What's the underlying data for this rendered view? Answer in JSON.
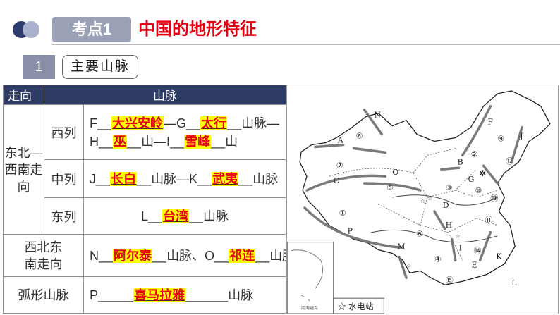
{
  "header": {
    "badge": "考点1",
    "title": "中国的地形特征",
    "section_number": "1",
    "section_title": "主要山脉"
  },
  "table": {
    "col_headers": [
      "走向",
      "山脉"
    ],
    "group1": "东北—西南走向",
    "row_west": {
      "label": "西列",
      "p1": "F",
      "a1": "大兴安岭",
      "p2": "—G",
      "a2": "太行",
      "p3": "山脉—",
      "p4": "H",
      "a3": "巫",
      "p5": "山—I",
      "a4": "雪峰",
      "p6": "山"
    },
    "row_mid": {
      "label": "中列",
      "p1": "J",
      "a1": "长白",
      "p2": "山脉—K",
      "a2": "武夷",
      "p3": "山脉"
    },
    "row_east": {
      "label": "东列",
      "p1": "L",
      "a1": "台湾",
      "p2": "山脉"
    },
    "group2": "西北东南走向",
    "row_nw": {
      "p1": "N",
      "a1": "阿尔泰",
      "p2": "山脉、O",
      "a2": "祁连",
      "p3": "山脉"
    },
    "group3": "弧形山脉",
    "row_arc": {
      "p1": "P",
      "a1": "喜马拉雅",
      "p2": "山脉"
    }
  },
  "map": {
    "letters": [
      "N",
      "A",
      "C",
      "P",
      "O",
      "B",
      "F",
      "J",
      "G",
      "D",
      "H",
      "M",
      "I",
      "E",
      "K",
      "L"
    ],
    "circled": [
      "⑥",
      "⑦",
      "⑤",
      "①",
      "②",
      "⑨",
      "⑫",
      "③",
      "⑩",
      "⑬",
      "⑪",
      "⑧",
      "④",
      "⑭",
      "⑮"
    ],
    "legend": "☆ 水电站",
    "inset_label": "南海诸岛"
  },
  "colors": {
    "title_red": "#e60012",
    "answer_highlight": "#ffff00",
    "table_header": "#2f3d66"
  }
}
